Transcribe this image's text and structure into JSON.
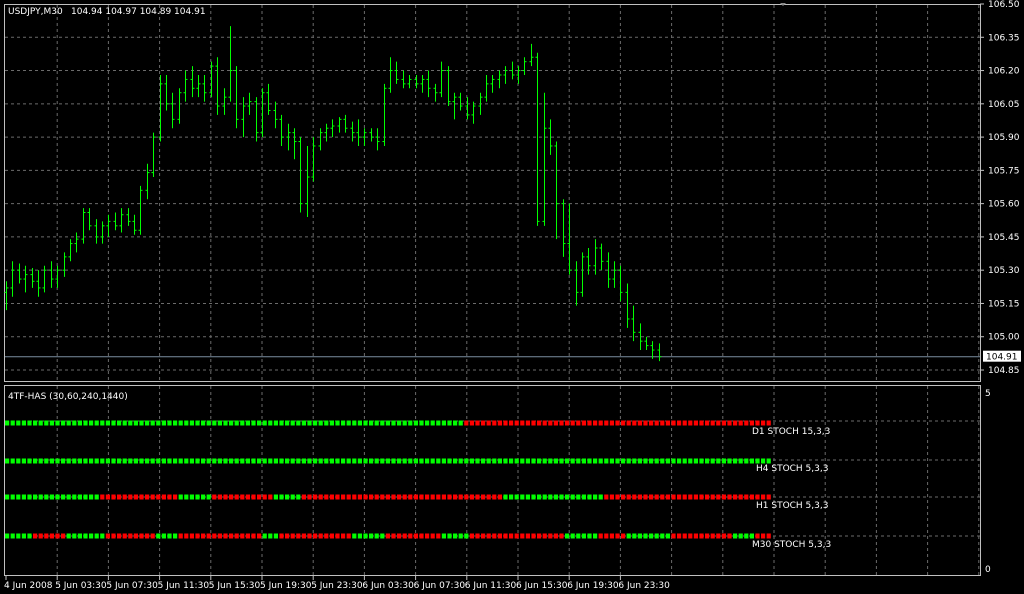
{
  "header": {
    "symbol_tf": "USDJPY,M30",
    "ohlc": "104.94 104.97 104.89 104.91"
  },
  "indicator": {
    "name": "4TF-HAS (30,60,240,1440)",
    "rows": [
      {
        "label": "D1  STOCH 15,3,3"
      },
      {
        "label": "H4  STOCH 5,3,3"
      },
      {
        "label": "H1  STOCH 5,3,3"
      },
      {
        "label": "M30  STOCH 5,3,3"
      }
    ],
    "axis_top": "5",
    "axis_bottom": "0"
  },
  "colors": {
    "background": "#000000",
    "grid": "#6b6b6b",
    "frame": "#c0c0c0",
    "candle": "#00ff00",
    "bull": "#00ff00",
    "bear": "#ff0000",
    "current_line": "#7a8ea0",
    "price_tag_bg": "#ffffff"
  },
  "chart_data": {
    "type": "ohlc",
    "symbol": "USDJPY",
    "timeframe": "M30",
    "current_price": "104.91",
    "price_ticks": [
      "106.50",
      "106.35",
      "106.20",
      "106.05",
      "105.90",
      "105.75",
      "105.60",
      "105.45",
      "105.30",
      "105.15",
      "105.00",
      "104.85"
    ],
    "ylim": [
      104.82,
      106.5
    ],
    "time_labels": [
      "4 Jun 2008",
      "5 Jun 03:30",
      "5 Jun 07:30",
      "5 Jun 11:30",
      "5 Jun 15:30",
      "5 Jun 19:30",
      "5 Jun 23:30",
      "6 Jun 03:30",
      "6 Jun 07:30",
      "6 Jun 11:30",
      "6 Jun 15:30",
      "6 Jun 19:30",
      "6 Jun 23:30"
    ],
    "bars_per_label": 8,
    "bars": [
      [
        105.2,
        105.25,
        105.12,
        105.22
      ],
      [
        105.22,
        105.34,
        105.18,
        105.3
      ],
      [
        105.3,
        105.33,
        105.24,
        105.26
      ],
      [
        105.26,
        105.32,
        105.2,
        105.28
      ],
      [
        105.28,
        105.31,
        105.22,
        105.25
      ],
      [
        105.25,
        105.3,
        105.18,
        105.22
      ],
      [
        105.22,
        105.32,
        105.2,
        105.3
      ],
      [
        105.3,
        105.34,
        105.22,
        105.26
      ],
      [
        105.26,
        105.32,
        105.22,
        105.3
      ],
      [
        105.3,
        105.38,
        105.27,
        105.36
      ],
      [
        105.36,
        105.44,
        105.34,
        105.42
      ],
      [
        105.42,
        105.47,
        105.38,
        105.44
      ],
      [
        105.44,
        105.58,
        105.42,
        105.56
      ],
      [
        105.56,
        105.58,
        105.48,
        105.5
      ],
      [
        105.5,
        105.53,
        105.42,
        105.45
      ],
      [
        105.45,
        105.52,
        105.42,
        105.5
      ],
      [
        105.5,
        105.55,
        105.45,
        105.52
      ],
      [
        105.52,
        105.56,
        105.48,
        105.5
      ],
      [
        105.5,
        105.58,
        105.47,
        105.55
      ],
      [
        105.55,
        105.58,
        105.5,
        105.52
      ],
      [
        105.52,
        105.55,
        105.46,
        105.48
      ],
      [
        105.48,
        105.68,
        105.46,
        105.66
      ],
      [
        105.66,
        105.78,
        105.62,
        105.74
      ],
      [
        105.74,
        105.92,
        105.72,
        105.9
      ],
      [
        105.9,
        106.18,
        105.88,
        106.14
      ],
      [
        106.14,
        106.18,
        106.02,
        106.05
      ],
      [
        106.05,
        106.1,
        105.94,
        105.98
      ],
      [
        105.98,
        106.12,
        105.96,
        106.1
      ],
      [
        106.1,
        106.2,
        106.06,
        106.16
      ],
      [
        106.16,
        106.22,
        106.08,
        106.12
      ],
      [
        106.12,
        106.18,
        106.08,
        106.14
      ],
      [
        106.14,
        106.18,
        106.06,
        106.1
      ],
      [
        106.1,
        106.24,
        106.08,
        106.22
      ],
      [
        106.22,
        106.26,
        106.0,
        106.04
      ],
      [
        106.04,
        106.12,
        106.0,
        106.08
      ],
      [
        106.08,
        106.4,
        106.06,
        106.2
      ],
      [
        106.2,
        106.22,
        105.94,
        105.98
      ],
      [
        105.98,
        106.08,
        105.9,
        106.04
      ],
      [
        106.04,
        106.1,
        106.0,
        106.06
      ],
      [
        106.06,
        106.08,
        105.88,
        105.92
      ],
      [
        105.92,
        106.12,
        105.9,
        106.1
      ],
      [
        106.1,
        106.14,
        106.0,
        106.02
      ],
      [
        106.02,
        106.06,
        105.94,
        105.98
      ],
      [
        105.98,
        106.0,
        105.86,
        105.9
      ],
      [
        105.9,
        105.96,
        105.84,
        105.92
      ],
      [
        105.92,
        105.94,
        105.8,
        105.88
      ],
      [
        105.88,
        105.9,
        105.56,
        105.6
      ],
      [
        105.6,
        105.86,
        105.54,
        105.72
      ],
      [
        105.72,
        105.9,
        105.7,
        105.86
      ],
      [
        105.86,
        105.94,
        105.84,
        105.92
      ],
      [
        105.92,
        105.96,
        105.88,
        105.94
      ],
      [
        105.94,
        105.98,
        105.9,
        105.95
      ],
      [
        105.95,
        105.99,
        105.92,
        105.98
      ],
      [
        105.98,
        106.0,
        105.92,
        105.94
      ],
      [
        105.94,
        105.97,
        105.88,
        105.92
      ],
      [
        105.92,
        105.98,
        105.86,
        105.9
      ],
      [
        105.9,
        105.94,
        105.86,
        105.92
      ],
      [
        105.92,
        105.94,
        105.88,
        105.9
      ],
      [
        105.9,
        105.94,
        105.84,
        105.88
      ],
      [
        105.88,
        106.14,
        105.86,
        106.12
      ],
      [
        106.12,
        106.26,
        106.1,
        106.2
      ],
      [
        106.2,
        106.24,
        106.14,
        106.16
      ],
      [
        106.16,
        106.2,
        106.12,
        106.14
      ],
      [
        106.14,
        106.18,
        106.12,
        106.16
      ],
      [
        106.16,
        106.18,
        106.12,
        106.14
      ],
      [
        106.14,
        106.18,
        106.1,
        106.16
      ],
      [
        106.16,
        106.2,
        106.08,
        106.12
      ],
      [
        106.12,
        106.14,
        106.06,
        106.1
      ],
      [
        106.1,
        106.24,
        106.08,
        106.2
      ],
      [
        106.2,
        106.22,
        106.04,
        106.06
      ],
      [
        106.06,
        106.1,
        105.98,
        106.08
      ],
      [
        106.08,
        106.1,
        106.02,
        106.04
      ],
      [
        106.04,
        106.08,
        105.98,
        106.0
      ],
      [
        106.0,
        106.06,
        105.96,
        106.04
      ],
      [
        106.04,
        106.1,
        106.0,
        106.08
      ],
      [
        106.08,
        106.18,
        106.06,
        106.14
      ],
      [
        106.14,
        106.18,
        106.1,
        106.16
      ],
      [
        106.16,
        106.2,
        106.12,
        106.18
      ],
      [
        106.18,
        106.22,
        106.14,
        106.2
      ],
      [
        106.2,
        106.24,
        106.16,
        106.18
      ],
      [
        106.18,
        106.22,
        106.14,
        106.2
      ],
      [
        106.2,
        106.26,
        106.18,
        106.24
      ],
      [
        106.24,
        106.32,
        106.22,
        106.26
      ],
      [
        106.26,
        106.28,
        105.5,
        105.52
      ],
      [
        105.52,
        106.1,
        105.5,
        105.94
      ],
      [
        105.94,
        105.98,
        105.82,
        105.86
      ],
      [
        105.86,
        105.88,
        105.44,
        105.6
      ],
      [
        105.6,
        105.62,
        105.36,
        105.42
      ],
      [
        105.42,
        105.6,
        105.28,
        105.3
      ],
      [
        105.3,
        105.34,
        105.14,
        105.2
      ],
      [
        105.2,
        105.38,
        105.18,
        105.36
      ],
      [
        105.36,
        105.4,
        105.28,
        105.32
      ],
      [
        105.32,
        105.44,
        105.28,
        105.4
      ],
      [
        105.4,
        105.42,
        105.3,
        105.34
      ],
      [
        105.34,
        105.38,
        105.22,
        105.26
      ],
      [
        105.26,
        105.34,
        105.22,
        105.3
      ],
      [
        105.3,
        105.32,
        105.16,
        105.2
      ],
      [
        105.2,
        105.24,
        105.04,
        105.08
      ],
      [
        105.08,
        105.14,
        104.98,
        105.02
      ],
      [
        105.02,
        105.06,
        104.94,
        104.98
      ],
      [
        104.98,
        105.0,
        104.94,
        104.96
      ],
      [
        104.96,
        104.98,
        104.9,
        104.94
      ],
      [
        104.94,
        104.97,
        104.89,
        104.91
      ]
    ],
    "signals": {
      "D1": "GGGGGGGGGGGGGGGGGGGGGGGGGGGGGGGGGGGGGGGGGGGGGGGGGGGGGGGGGGGGGGGGGGGGGGGGGGGGGGGGGGRRRRRRRRRRRRRRRRRRRRRRRRRRRRRRRRRRRRRRRRRRRRRRRRRRRRRRRRRRRRRRRRRRRRRRRRRRR",
      "H4": "GGGGGGGGGGGGGGGGGGGGGGGGGGGGGGGGGGGGGGGGGGGGGGGGGGGGGGGGGGGGGGGGGGGGGGGGGGGGGGGGGGGGGGGGGGGGGGGGGGGGGGGGGGGGGGGGGGGGGGGGGGGGGGGGGGGGGGGGGGGGGGGGGGGGGGGGGGGGGGGG",
      "H1": "GGGGGGGGGGGGGGGGGRRRRRRRRRRRRRRGGGGGGRRRRRRRRRRRGGGGGRRRRRRRRRRRRRRRRRRRRRRRRRRRRRRRRRRRRGGGGGGGGGGGGGGGGGGRRRRRRRRRRRRRRRRRRRRRRRRRRRRRRRRRRRRRRRRRRRRRRRRRRRRRRRRRR",
      "M30": "GGGGGRRRRRRGGGGGGGRRRRRRRRRGGGGRRRRRRRRRRRRRRRGGGRRRRRRRRRRRRRGGGGGGRRRRRRRRRRGGGGGRRRRRRRRRRRRRRRRRGGGGGGRRRRRGGGGGGGGRRRRRRRRRRRGGGGRRRRRRRRRRRRRRRGGGGGGGRRRRRRR"
    }
  }
}
